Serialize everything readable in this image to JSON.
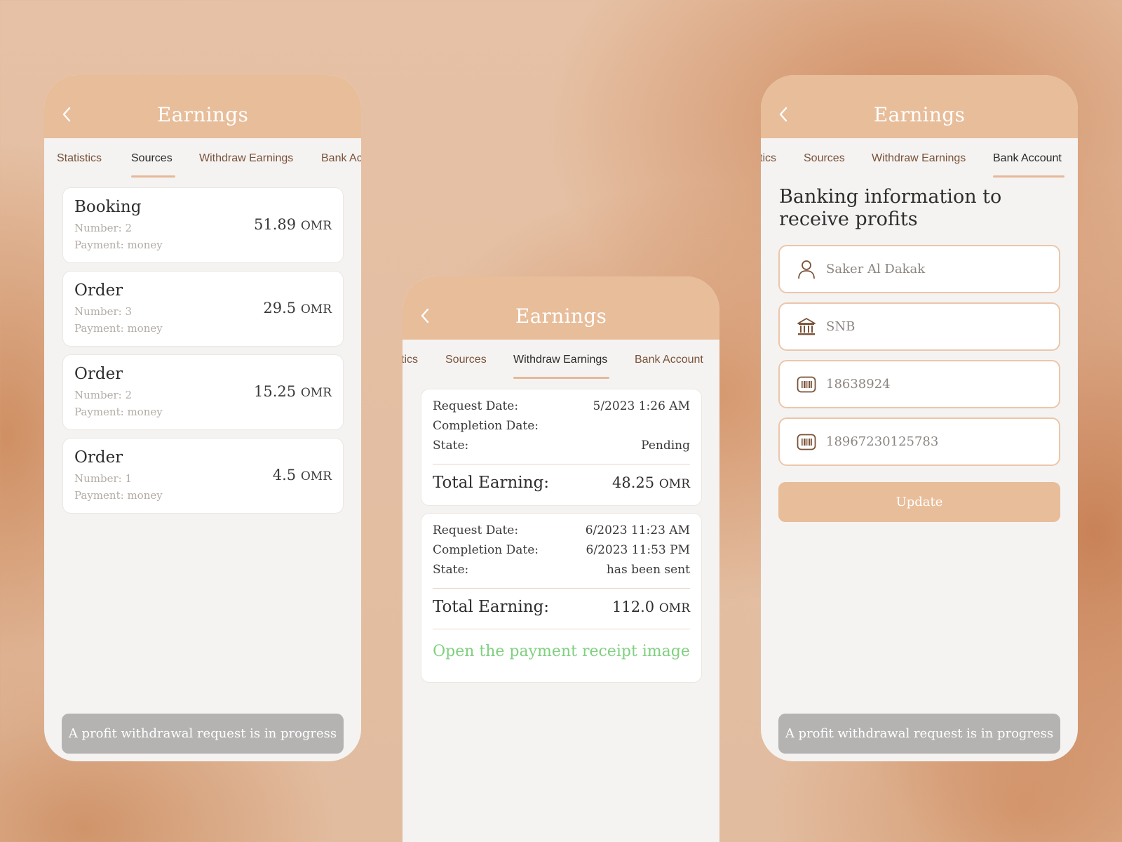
{
  "colors": {
    "header_bg": "#e8bd9a",
    "screen_bg": "#f4f3f2",
    "tab_text": "#7a5238",
    "tab_active": "#2a2a2a",
    "link_green": "#7fd07f",
    "disabled_button": "#b4b3b2"
  },
  "icons": {
    "back": "chevron-left-icon",
    "name": "user-icon",
    "bank": "bank-building-icon",
    "account": "barcode-card-icon",
    "iban": "barcode-card-icon"
  },
  "screens": {
    "sources": {
      "title": "Earnings",
      "tabs": [
        "Statistics",
        "Sources",
        "Withdraw Earnings",
        "Bank Ac"
      ],
      "active_tab": "Sources",
      "items": [
        {
          "title": "Booking",
          "number": "Number: 2",
          "payment": "Payment: money",
          "amount": "51.89",
          "currency": "OMR"
        },
        {
          "title": "Order",
          "number": "Number: 3",
          "payment": "Payment: money",
          "amount": "29.5",
          "currency": "OMR"
        },
        {
          "title": "Order",
          "number": "Number: 2",
          "payment": "Payment: money",
          "amount": "15.25",
          "currency": "OMR"
        },
        {
          "title": "Order",
          "number": "Number: 1",
          "payment": "Payment: money",
          "amount": "4.5",
          "currency": "OMR"
        }
      ],
      "footer_button": "A profit withdrawal request is in progress"
    },
    "withdraw": {
      "title": "Earnings",
      "tabs": [
        "tics",
        "Sources",
        "Withdraw Earnings",
        "Bank Account"
      ],
      "active_tab": "Withdraw Earnings",
      "labels": {
        "request_date": "Request Date:",
        "completion_date": "Completion Date:",
        "state": "State:",
        "total": "Total Earning:"
      },
      "requests": [
        {
          "request_date": "5/2023 1:26 AM",
          "completion_date": "",
          "state": "Pending",
          "total": "48.25",
          "currency": "OMR"
        },
        {
          "request_date": "6/2023 11:23 AM",
          "completion_date": "6/2023 11:53 PM",
          "state": "has been sent",
          "total": "112.0",
          "currency": "OMR",
          "link": "Open the payment receipt image"
        }
      ]
    },
    "bank": {
      "title": "Earnings",
      "tabs": [
        "tics",
        "Sources",
        "Withdraw Earnings",
        "Bank Account"
      ],
      "active_tab": "Bank Account",
      "heading": "Banking information to receive profits",
      "fields": {
        "name": "Saker Al Dakak",
        "bank": "SNB",
        "account": "18638924",
        "iban": "18967230125783"
      },
      "update_button": "Update",
      "footer_button": "A profit withdrawal request is in progress"
    }
  }
}
